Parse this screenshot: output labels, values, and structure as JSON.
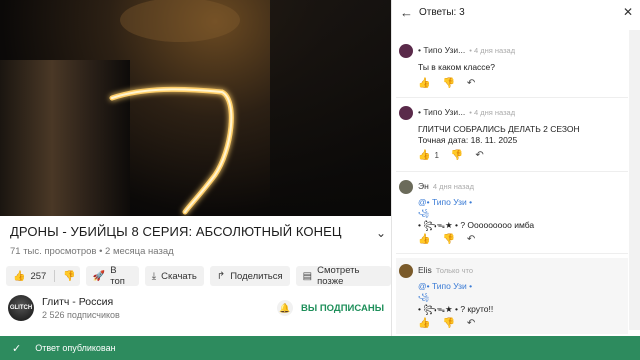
{
  "video": {
    "title": "ДРОНЫ - УБИЙЦЫ 8 СЕРИЯ: АБСОЛЮТНЫЙ КОНЕЦ",
    "meta": "71 тыс. просмотров • 2 месяца назад",
    "likes": "257",
    "actions": {
      "to_top": "В топ",
      "download": "Скачать",
      "share": "Поделиться",
      "watch_later": "Смотреть позже"
    }
  },
  "channel": {
    "avatar_text": "GLITCH",
    "name": "Глитч - Россия",
    "subscribers": "2 526 подписчиков",
    "subscribed_label": "ВЫ ПОДПИСАНЫ"
  },
  "replies": {
    "title": "Ответы: 3",
    "comments": [
      {
        "author": "• Типо Узи...",
        "time": "• 4 дня назад",
        "lines": [
          "Ты в каком классе?"
        ],
        "avatar_color": "#5a2a4a"
      },
      {
        "author": "• Типо Узи...",
        "time": "• 4 дня назад",
        "lines": [
          "ГЛИТЧИ СОБРАЛИСЬ ДЕЛАТЬ 2 СЕЗОН",
          "Точная дата: 18. 11. 2025"
        ],
        "likes": "1",
        "avatar_color": "#5a2a4a"
      },
      {
        "author": "Эн",
        "time": "4 дня назад",
        "mention": "@• Типо Узи •",
        "small": "꧁",
        "text": "• ꧂ᯓ★ • ? Ооооооооо имба",
        "avatar_color": "#6b6b5a"
      },
      {
        "author": "Elis",
        "time": "Только что",
        "mention": "@• Типо Узи •",
        "small": "꧁",
        "text": "• ꧂ᯓ★ • ? круто!!",
        "avatar_color": "#7a5a2a"
      }
    ]
  },
  "toast": {
    "text": "Ответ опубликован"
  },
  "colors": {
    "accent_green": "#2d8b5e",
    "subscribed_green": "#1e8f5a",
    "mention_blue": "#3a7bd5"
  }
}
